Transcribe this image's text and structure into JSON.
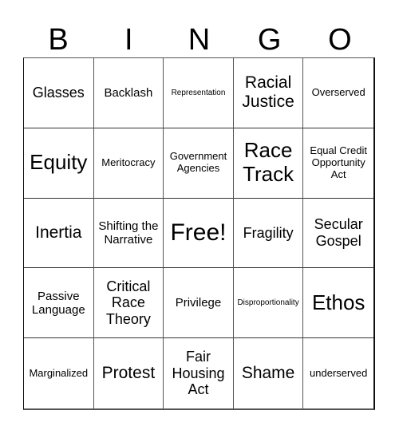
{
  "header": {
    "letters": [
      "B",
      "I",
      "N",
      "G",
      "O"
    ]
  },
  "cells": [
    {
      "text": "Glasses"
    },
    {
      "text": "Backlash"
    },
    {
      "text": "Representation"
    },
    {
      "text": "Racial Justice"
    },
    {
      "text": "Overserved"
    },
    {
      "text": "Equity"
    },
    {
      "text": "Meritocracy"
    },
    {
      "text": "Government Agencies"
    },
    {
      "text": "Race Track"
    },
    {
      "text": "Equal Credit Opportunity Act"
    },
    {
      "text": "Inertia"
    },
    {
      "text": "Shifting the Narrative"
    },
    {
      "text": "Free!"
    },
    {
      "text": "Fragility"
    },
    {
      "text": "Secular Gospel"
    },
    {
      "text": "Passive Language"
    },
    {
      "text": "Critical Race Theory"
    },
    {
      "text": "Privilege"
    },
    {
      "text": "Disproportionality"
    },
    {
      "text": "Ethos"
    },
    {
      "text": "Marginalized"
    },
    {
      "text": "Protest"
    },
    {
      "text": "Fair Housing Act"
    },
    {
      "text": "Shame"
    },
    {
      "text": "underserved"
    }
  ]
}
